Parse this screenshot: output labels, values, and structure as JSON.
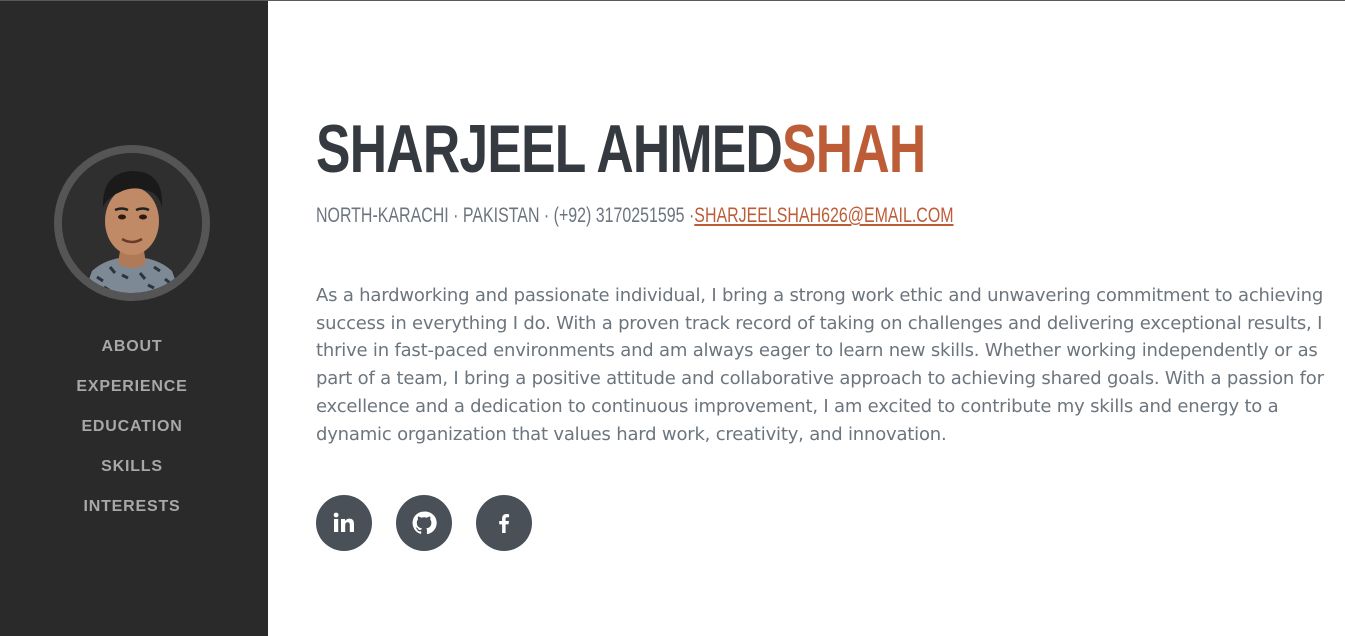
{
  "sidebar": {
    "nav": [
      {
        "label": "ABOUT"
      },
      {
        "label": "EXPERIENCE"
      },
      {
        "label": "EDUCATION"
      },
      {
        "label": "SKILLS"
      },
      {
        "label": "INTERESTS"
      }
    ]
  },
  "about": {
    "first_name": "SHARJEEL AHMED",
    "last_name": "SHAH",
    "address": "NORTH-KARACHI · PAKISTAN · (+92) 3170251595 ·",
    "email": "SHARJEELSHAH626@EMAIL.COM",
    "bio_lines": [
      "As a hardworking and passionate individual, I bring a strong work ethic and unwavering commitment to achieving",
      "success in everything I do. With a proven track record of taking on challenges and delivering exceptional results, I",
      "thrive in fast-paced environments and am always eager to learn new skills. Whether working independently or as",
      "part of a team, I bring a positive attitude and collaborative approach to achieving shared goals. With a passion for",
      "excellence and a dedication to continuous improvement, I am excited to contribute my skills and energy to a",
      "dynamic organization that values hard work, creativity, and innovation."
    ]
  },
  "social": [
    {
      "icon": "linkedin-icon"
    },
    {
      "icon": "github-icon"
    },
    {
      "icon": "facebook-icon"
    }
  ],
  "colors": {
    "sidebar_bg": "#2a2a2a",
    "accent": "#bd5d38",
    "heading": "#343a40",
    "text_muted": "#6c757d",
    "social_bg": "#495057"
  }
}
